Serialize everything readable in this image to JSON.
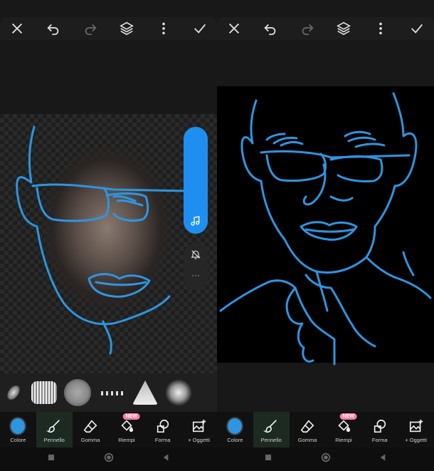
{
  "panels": [
    {
      "id": "left",
      "brushes": [
        "brush-1",
        "brush-2",
        "brush-3",
        "brush-4",
        "brush-5",
        "brush-6",
        "brush-7"
      ],
      "tools": [
        {
          "label": "Colore",
          "icon": "color-dot"
        },
        {
          "label": "Pennello",
          "icon": "brush-icon",
          "active": true
        },
        {
          "label": "Gomma",
          "icon": "eraser-icon"
        },
        {
          "label": "Riempi",
          "icon": "fill-bucket-icon",
          "badge": "NEW"
        },
        {
          "label": "Forma",
          "icon": "shape-icon"
        },
        {
          "label": "+ Oggetti",
          "icon": "image-add-icon"
        }
      ]
    },
    {
      "id": "right",
      "tools": [
        {
          "label": "Colore",
          "icon": "color-dot"
        },
        {
          "label": "Pennello",
          "icon": "brush-icon",
          "active": true
        },
        {
          "label": "Gomma",
          "icon": "eraser-icon"
        },
        {
          "label": "Riempi",
          "icon": "fill-bucket-icon",
          "badge": "NEW"
        },
        {
          "label": "Forma",
          "icon": "shape-icon"
        },
        {
          "label": "+ Oggetti",
          "icon": "image-add-icon"
        }
      ]
    }
  ],
  "colors": {
    "accent": "#1e8ff0",
    "brush_color": "#2e95e0",
    "active_tool_bg": "#1c2a22",
    "badge": "#ff7ba6"
  }
}
